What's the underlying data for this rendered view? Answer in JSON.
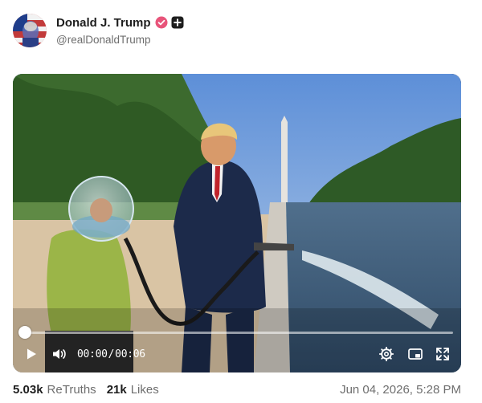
{
  "user": {
    "display_name": "Donald J. Trump",
    "handle": "@realDonaldTrump",
    "verified_icon": "verified-badge-icon",
    "plus_icon": "plus-square-icon"
  },
  "video": {
    "current_time": "00:00",
    "separator": "/",
    "duration": "00:06",
    "progress_fraction": 0.0,
    "controls": [
      "play-icon",
      "volume-icon",
      "settings-gear-icon",
      "picture-in-picture-icon",
      "fullscreen-icon"
    ]
  },
  "stats": {
    "retruths_count": "5.03k",
    "retruths_label": "ReTruths",
    "likes_count": "21k",
    "likes_label": "Likes"
  },
  "timestamp": "Jun 04, 2026, 5:28 PM",
  "colors": {
    "verified_badge": "#e8547a",
    "text_primary": "#1e1e1e",
    "text_secondary": "#6e6e6e"
  }
}
